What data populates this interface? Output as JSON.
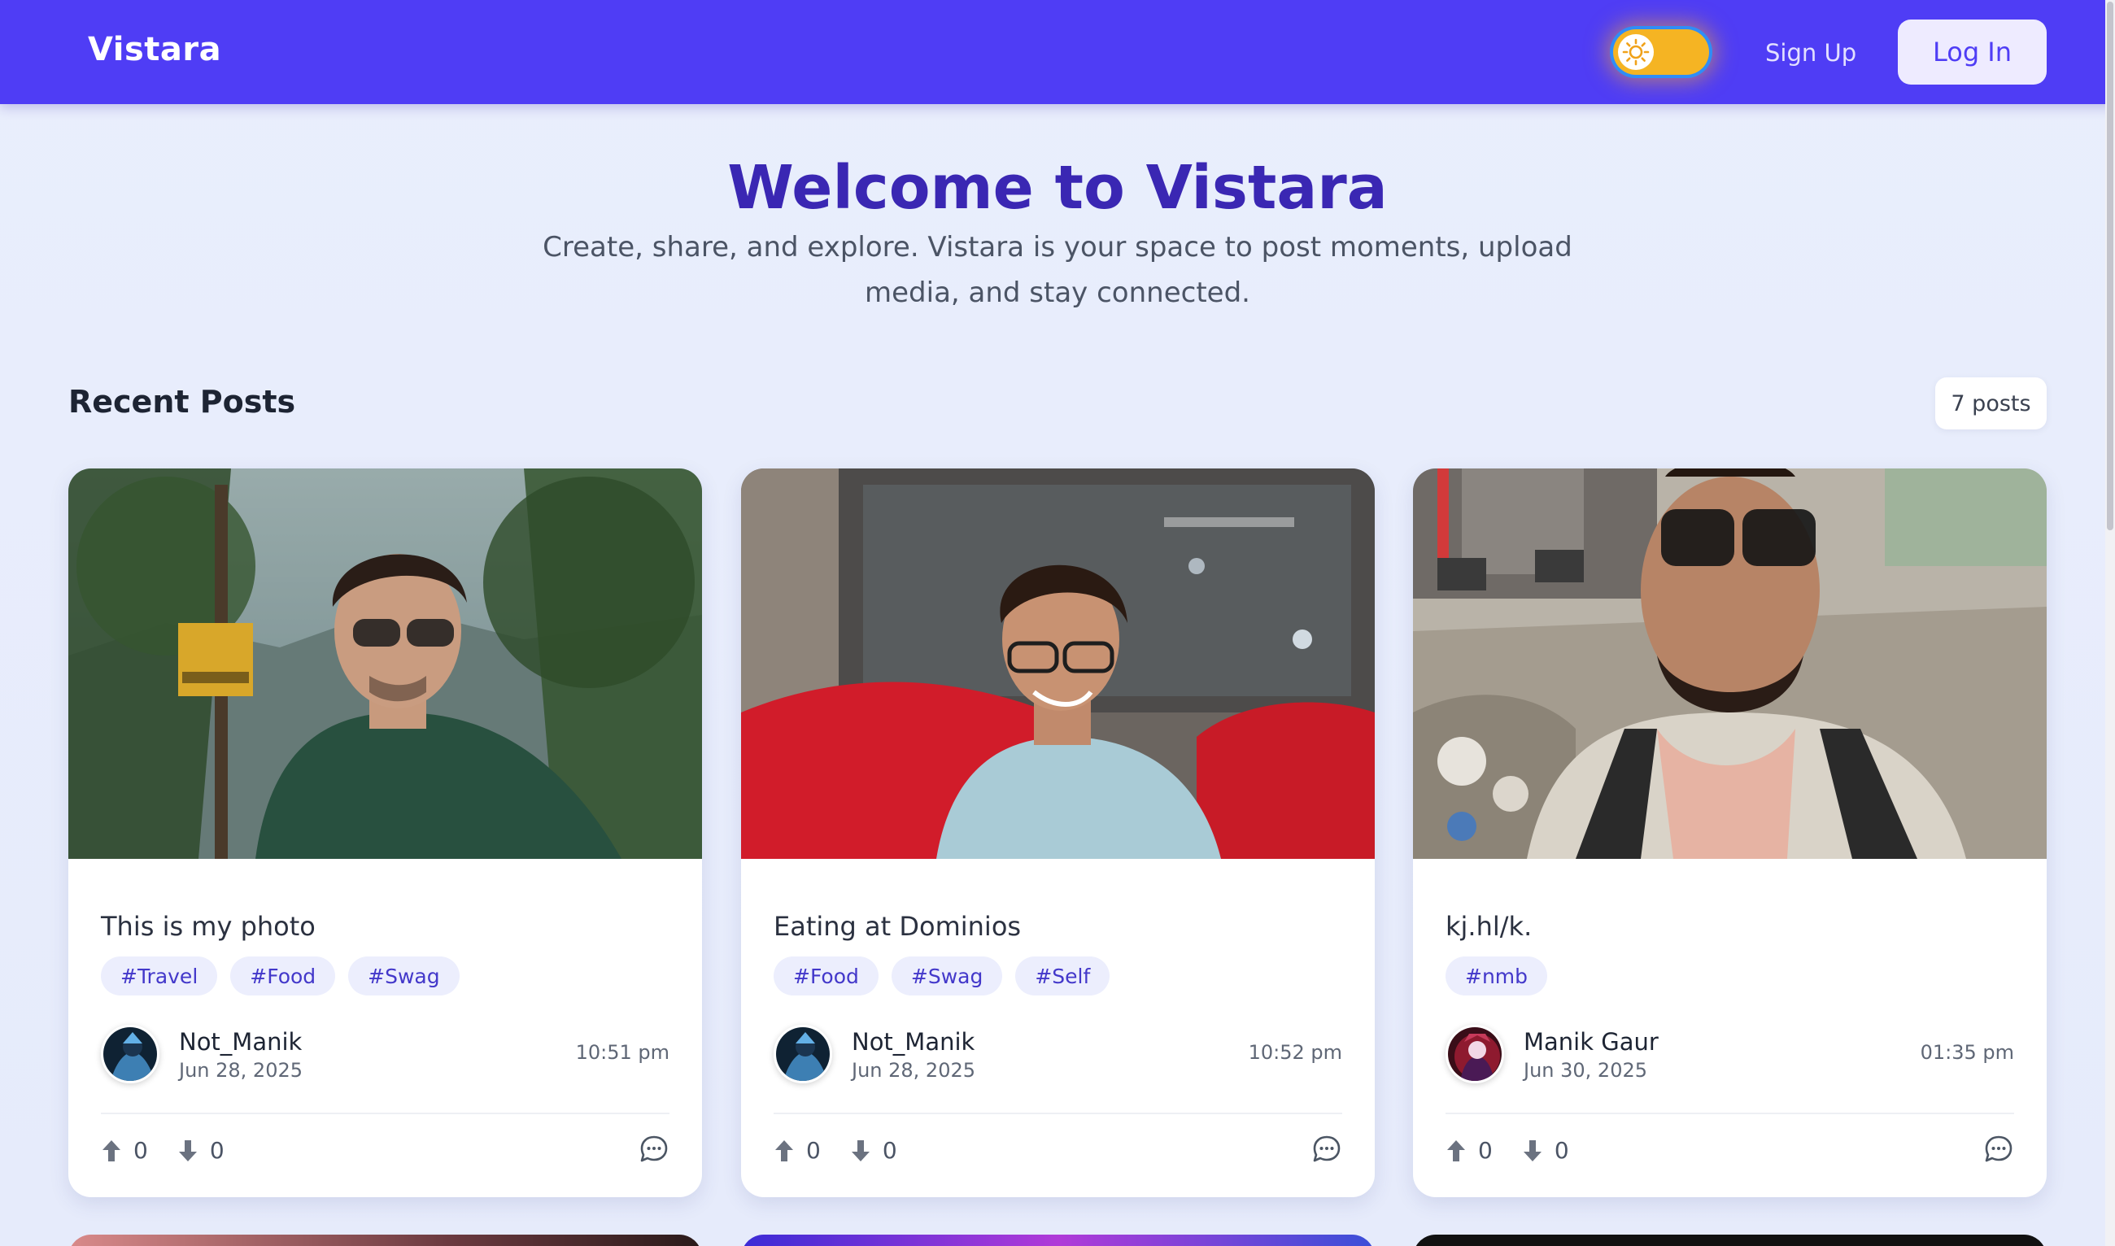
{
  "navbar": {
    "brand": "Vistara",
    "theme_toggle_icon": "sun-icon",
    "signup_label": "Sign Up",
    "login_label": "Log In",
    "accent_color": "#4f3df5"
  },
  "hero": {
    "title": "Welcome to Vistara",
    "subtitle": "Create, share, and explore. Vistara is your space to post moments, upload media, and stay connected."
  },
  "section": {
    "title": "Recent Posts",
    "count_label": "7 posts"
  },
  "posts": [
    {
      "caption": "This is my photo",
      "tags": [
        "#Travel",
        "#Food",
        "#Swag"
      ],
      "author": "Not_Manik",
      "date": "Jun 28, 2025",
      "time": "10:51 pm",
      "upvotes": "0",
      "downvotes": "0"
    },
    {
      "caption": "Eating at Dominios",
      "tags": [
        "#Food",
        "#Swag",
        "#Self"
      ],
      "author": "Not_Manik",
      "date": "Jun 28, 2025",
      "time": "10:52 pm",
      "upvotes": "0",
      "downvotes": "0"
    },
    {
      "caption": "kj.hl/k.",
      "tags": [
        "#nmb"
      ],
      "author": "Manik Gaur",
      "date": "Jun 30, 2025",
      "time": "01:35 pm",
      "upvotes": "0",
      "downvotes": "0"
    }
  ],
  "icons": {
    "upvote": "arrow-up-icon",
    "downvote": "arrow-down-icon",
    "comment": "comment-bubble-icon"
  }
}
